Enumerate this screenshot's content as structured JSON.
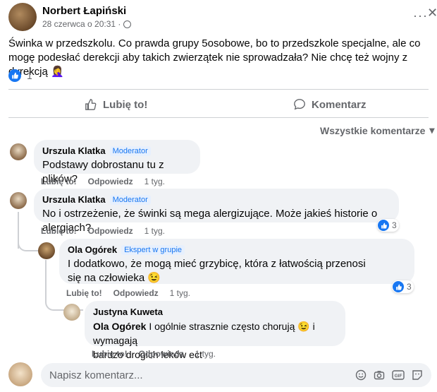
{
  "post": {
    "author": "Norbert Łapiński",
    "date": "28 czerwca o 20:31 ·",
    "text": "Świnka w przedszkolu. Co prawda grupy 5osobowe, bo to przedszkole specjalne, ale co mogę podesłać derekcji aby takich zwierzątek nie sprowadzała? Nie chcę też wojny z dyrekcją 🤦‍♀️",
    "reaction_count": "1",
    "menu_glyph": "···",
    "close_glyph": "✕"
  },
  "actions": {
    "like": "Lubię to!",
    "comment": "Komentarz"
  },
  "filter": {
    "label": "Wszystkie komentarze",
    "arrow": "▾"
  },
  "comments": [
    {
      "author": "Urszula Klatka",
      "badge": "Moderator",
      "text": "Podstawy dobrostanu tu z plików?",
      "like": "Lubię to!",
      "reply": "Odpowiedz",
      "time": "1 tyg."
    },
    {
      "author": "Urszula Klatka",
      "badge": "Moderator",
      "text": "No i ostrzeżenie, że świnki są mega alergizujące. Może jakieś historie o alergiach?",
      "like": "Lubię to!",
      "reply": "Odpowiedz",
      "time": "1 tyg.",
      "reactions": "3"
    },
    {
      "author": "Ola Ogórek",
      "badge": "Ekspert w grupie",
      "text": "I dodatkowo, że mogą mieć grzybicę, która z łatwością przenosi się na człowieka 😉",
      "like": "Lubię to!",
      "reply": "Odpowiedz",
      "time": "1 tyg.",
      "reactions": "3"
    },
    {
      "author": "Justyna Kuweta",
      "mention": "Ola Ogórek",
      "text_a": " I ogólnie strasznie często chorują 😉 i wymagają",
      "text_b": "bardzo drogich leków ect",
      "like": "Lubię to!",
      "reply": "Odpowiedz",
      "time": "1 tyg."
    }
  ],
  "composer": {
    "placeholder": "Napisz komentarz..."
  },
  "colors": {
    "accent": "#1877f2",
    "muted": "#65676b",
    "bubble": "#f0f2f5"
  }
}
